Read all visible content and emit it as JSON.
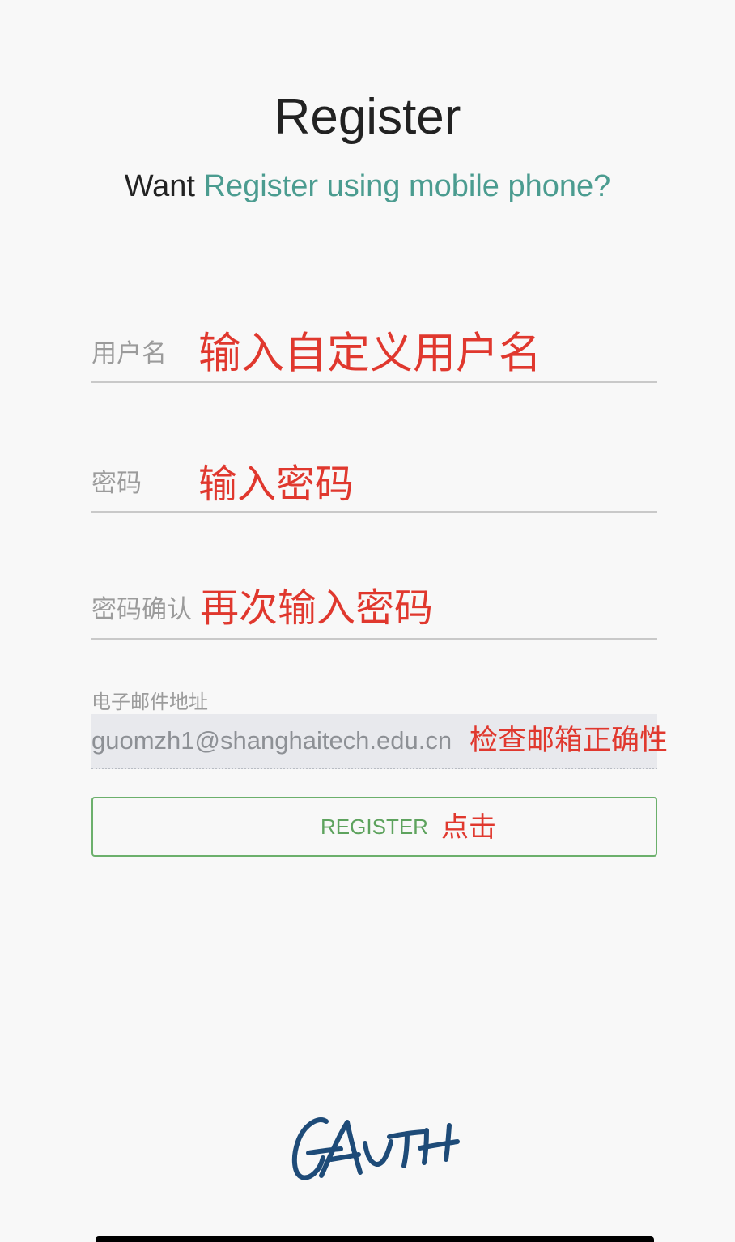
{
  "colors": {
    "background": "#f8f8f8",
    "text": "#222222",
    "link": "#4b9c90",
    "label": "#9b9b9b",
    "annotation": "#e0382e",
    "button": "#5ea35e",
    "logo": "#1e4b78",
    "input_bg": "#e8e9ed"
  },
  "header": {
    "title": "Register",
    "prompt_prefix": "Want",
    "mobile_link": "Register using mobile phone?"
  },
  "form": {
    "username": {
      "label": "用户名",
      "value": ""
    },
    "password": {
      "label": "密码",
      "value": ""
    },
    "password_confirm": {
      "label": "密码确认",
      "value": ""
    },
    "email": {
      "label": "电子邮件地址",
      "value": "guomzh1@shanghaitech.edu.cn"
    },
    "submit_label": "REGISTER"
  },
  "annotations": {
    "username": "输入自定义用户名",
    "password": "输入密码",
    "password_confirm": "再次输入密码",
    "email": "检查邮箱正确性",
    "submit": "点击"
  },
  "logo": {
    "text": "GAUTH"
  }
}
